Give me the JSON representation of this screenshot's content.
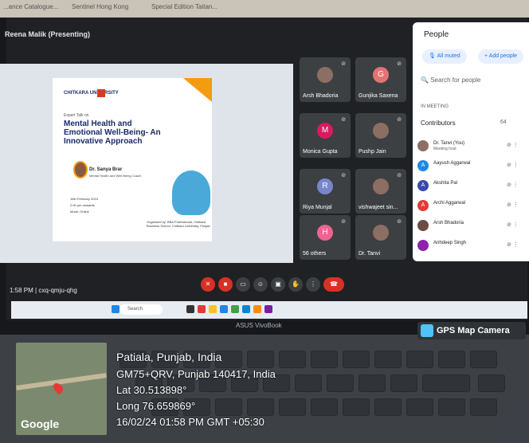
{
  "browser": {
    "tabs": [
      "...ance Catalogue...",
      "Sentinel Hong Kong",
      "Special Edition Taitan..."
    ]
  },
  "meet": {
    "presenter_label": "Reena Malik (Presenting)",
    "time": "1:58 PM",
    "meeting_code": "cxq-qmju-qhg",
    "slide": {
      "brand": "CHITKARA UNIVERSITY",
      "expert_talk": "Expert Talk on",
      "title": "Mental Health and Emotional Well-Being- An Innovative Approach",
      "speaker": "Dr. Sanya Brar",
      "speaker_role": "Mental Health and Well Being Coach",
      "date": "16th February 2024",
      "time": "2:00 pm onwards",
      "mode": "Mode: Online",
      "organizer": "Organised by: BBA Professional, Chitkara Business School, Chitkara University, Punjab"
    },
    "tiles": [
      {
        "name": "Arsh Bhadoria",
        "initial": "",
        "color": "#3c4043"
      },
      {
        "name": "Gunjika Saxena",
        "initial": "G",
        "color": "#e57373"
      },
      {
        "name": "Monica Gupta",
        "initial": "M",
        "color": "#d81b60"
      },
      {
        "name": "Pushp Jain",
        "initial": "",
        "color": "#3c4043"
      },
      {
        "name": "Riya Munjal",
        "initial": "R",
        "color": "#7986cb"
      },
      {
        "name": "vishwajeet sin...",
        "initial": "",
        "color": "#3c4043"
      },
      {
        "name": "56 others",
        "initial": "H",
        "color": "#f06292"
      },
      {
        "name": "Dr. Tanvi",
        "initial": "",
        "color": "#3c4043"
      }
    ],
    "people": {
      "title": "People",
      "all_muted": "All muted",
      "add_people": "Add people",
      "search_placeholder": "Search for people",
      "in_meeting": "IN MEETING",
      "contributors": "Contributors",
      "count": "64",
      "list": [
        {
          "name": "Dr. Tanvi (You)",
          "sub": "Meeting host",
          "initial": "",
          "color": "#8d6e63"
        },
        {
          "name": "Aayush Aggarwal",
          "sub": "",
          "initial": "A",
          "color": "#1e88e5"
        },
        {
          "name": "Akshita Pal",
          "sub": "",
          "initial": "A",
          "color": "#3949ab"
        },
        {
          "name": "Archi Aggarwal",
          "sub": "",
          "initial": "A",
          "color": "#e53935"
        },
        {
          "name": "Arsh Bhadoria",
          "sub": "",
          "initial": "",
          "color": "#6d4c41"
        },
        {
          "name": "Anhdeep Singh",
          "sub": "",
          "initial": "",
          "color": "#8e24aa"
        }
      ]
    }
  },
  "taskbar": {
    "search_label": "Search"
  },
  "laptop": {
    "brand": "ASUS VivoBook"
  },
  "gps": {
    "badge": "GPS Map Camera",
    "map_logo": "Google",
    "city": "Patiala, Punjab, India",
    "address": "GM75+QRV, Punjab 140417, India",
    "lat": "Lat 30.513898°",
    "long": "Long 76.659869°",
    "datetime": "16/02/24 01:58 PM GMT +05:30"
  }
}
